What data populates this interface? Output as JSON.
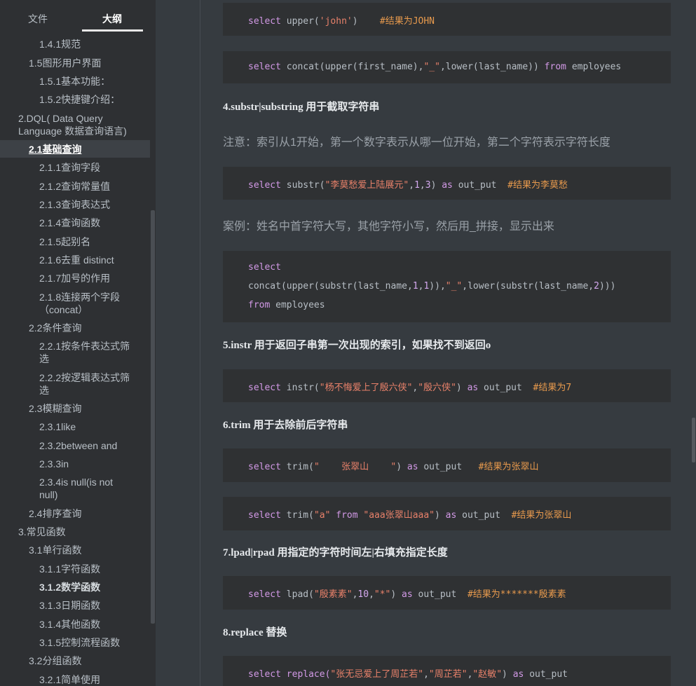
{
  "sidebar": {
    "tabs": {
      "files": "文件",
      "outline": "大纲"
    },
    "items": [
      "1.4.1规范",
      "1.5图形用户界面",
      "1.5.1基本功能：",
      "1.5.2快捷键介绍：",
      "2.DQL( Data Query Language 数据查询语言)",
      "2.1基础查询",
      "2.1.1查询字段",
      "2.1.2查询常量值",
      "2.1.3查询表达式",
      "2.1.4查询函数",
      "2.1.5起别名",
      "2.1.6去重 distinct",
      "2.1.7加号的作用",
      "2.1.8连接两个字段（concat）",
      "2.2条件查询",
      "2.2.1按条件表达式筛选",
      "2.2.2按逻辑表达式筛选",
      "2.3模糊查询",
      "2.3.1like",
      "2.3.2between and",
      "2.3.3in",
      "2.3.4is null(is not null)",
      "2.4排序查询",
      "3.常见函数",
      "3.1单行函数",
      "3.1.1字符函数",
      "3.1.2数学函数",
      "3.1.3日期函数",
      "3.1.4其他函数",
      "3.1.5控制流程函数",
      "3.2分组函数",
      "3.2.1简单使用"
    ]
  },
  "main": {
    "code1": {
      "kw": "select",
      "fn": "upper(",
      "str": "'john'",
      "end": ")",
      "comment": "#结果为JOHN"
    },
    "code2": {
      "kw": "select",
      "a": "concat(upper(first_name),",
      "str": "\"_\"",
      "b": ",lower(last_name))",
      "from": "from",
      "tail": "employees"
    },
    "h4": "4.substr|substring 用于截取字符串",
    "note1": "注意：索引从1开始，第一个数字表示从哪一位开始，第二个字符表示字符长度",
    "code3": {
      "kw": "select",
      "a": "substr(",
      "str": "\"李莫愁爱上陆展元\"",
      "n1": ",",
      "num1": "1",
      "c": ",",
      "num2": "3",
      "b": ")",
      "as": "as",
      "alias": "out_put",
      "comment": "#结果为李莫愁"
    },
    "note2": "案例：姓名中首字符大写，其他字符小写，然后用_拼接，显示出来",
    "code4": {
      "kw": "select",
      "a": "concat(upper(substr(last_name,",
      "n1": "1",
      "b": ",",
      "n2": "1",
      "c": ")),",
      "str": "\"_\"",
      "d": ",lower(substr(last_name,",
      "n3": "2",
      "e": ")))",
      "from": "from",
      "tail": "employees"
    },
    "h5": "5.instr 用于返回子串第一次出现的索引，如果找不到返回o",
    "code5": {
      "kw": "select",
      "a": "instr(",
      "s1": "\"杨不悔爱上了殷六侠\"",
      "c": ",",
      "s2": "\"殷六侠\"",
      "b": ")",
      "as": "as",
      "alias": "out_put",
      "comment": "#结果为7"
    },
    "h6": "6.trim 用于去除前后字符串",
    "code6": {
      "kw": "select",
      "a": "trim(",
      "str": "\"    张翠山    \"",
      "b": ")",
      "as": "as",
      "alias": "out_put",
      "comment": "#结果为张翠山"
    },
    "code7": {
      "kw": "select",
      "a": "trim(",
      "s1": "\"a\"",
      "from": "from",
      "s2": "\"aaa张翠山aaa\"",
      "b": ")",
      "as": "as",
      "alias": "out_put",
      "comment": "#结果为张翠山"
    },
    "h7": "7.lpad|rpad 用指定的字符时间左|右填充指定长度",
    "code8": {
      "kw": "select",
      "a": "lpad(",
      "s1": "\"殷素素\"",
      "c": ",",
      "num": "10",
      "d": ",",
      "s2": "\"*\"",
      "b": ")",
      "as": "as",
      "alias": "out_put",
      "comment": "#结果为*******殷素素"
    },
    "h8": "8.replace 替换",
    "code9": {
      "kw": "select",
      "a": "replace(",
      "s1": "\"张无忌爱上了周芷若\"",
      "c": ",",
      "s2": "\"周芷若\"",
      "d": ",",
      "s3": "\"赵敏\"",
      "b": ")",
      "as": "as",
      "alias": "out_put"
    }
  },
  "colors": {
    "keyword": "#d299e6",
    "string": "#e8816a",
    "comment": "#e89a4d",
    "number": "#d5a9f0"
  }
}
